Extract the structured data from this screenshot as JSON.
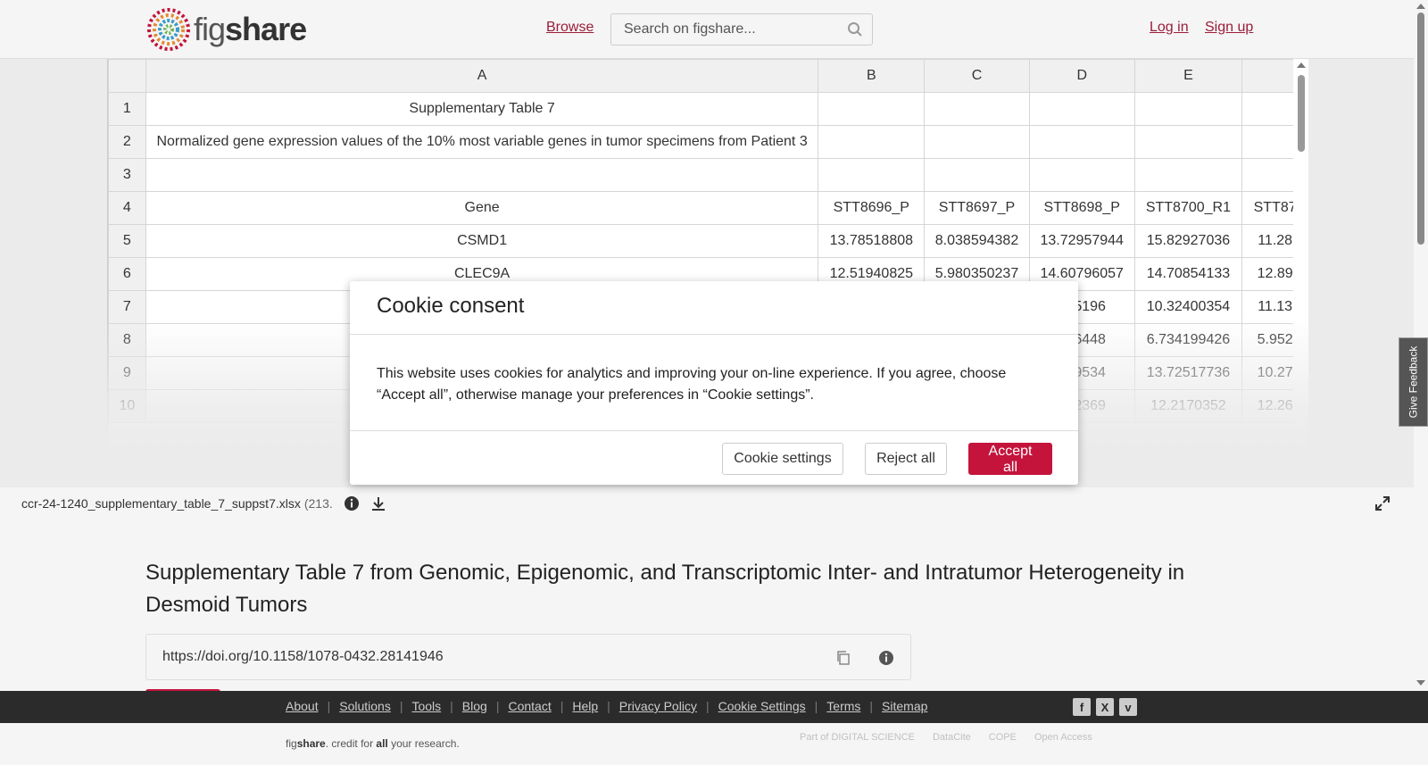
{
  "header": {
    "logo_prefix": "fig",
    "logo_suffix": "share",
    "browse": "Browse",
    "search_placeholder": "Search on figshare...",
    "login": "Log in",
    "signup": "Sign up"
  },
  "sheet": {
    "columns": [
      "A",
      "B",
      "C",
      "D",
      "E"
    ],
    "rows": [
      {
        "num": "1",
        "cells": [
          "Supplementary Table 7",
          "",
          "",
          "",
          "",
          ""
        ]
      },
      {
        "num": "2",
        "cells": [
          "Normalized gene expression values of the 10% most variable genes in tumor specimens from Patient 3",
          "",
          "",
          "",
          "",
          ""
        ]
      },
      {
        "num": "3",
        "cells": [
          "",
          "",
          "",
          "",
          "",
          ""
        ]
      },
      {
        "num": "4",
        "cells": [
          "Gene",
          "STT8696_P",
          "STT8697_P",
          "STT8698_P",
          "STT8700_R1",
          "STT87"
        ]
      },
      {
        "num": "5",
        "cells": [
          "CSMD1",
          "13.78518808",
          "8.038594382",
          "13.72957944",
          "15.82927036",
          "11.28"
        ]
      },
      {
        "num": "6",
        "cells": [
          "CLEC9A",
          "12.51940825",
          "5.980350237",
          "14.60796057",
          "14.70854133",
          "12.89"
        ]
      },
      {
        "num": "7",
        "cells": [
          "",
          "",
          "",
          "015196",
          "10.32400354",
          "11.13"
        ]
      },
      {
        "num": "8",
        "cells": [
          "",
          "",
          "",
          "546448",
          "6.734199426",
          "5.952"
        ]
      },
      {
        "num": "9",
        "cells": [
          "",
          "",
          "",
          "649534",
          "13.72517736",
          "10.27"
        ]
      },
      {
        "num": "10",
        "cells": [
          "",
          "",
          "",
          "822369",
          "12.2170352",
          "12.26"
        ]
      }
    ]
  },
  "file": {
    "name": "ccr-24-1240_supplementary_table_7_suppst7.xlsx",
    "size": "(213."
  },
  "article": {
    "title": "Supplementary Table 7 from Genomic, Epigenomic, and Transcriptomic Inter- and Intratumor Heterogeneity in Desmoid Tumors",
    "doi": "https://doi.org/10.1158/1078-0432.28141946"
  },
  "feedback": "Give Feedback",
  "footer": {
    "links": [
      "About",
      "Solutions",
      "Tools",
      "Blog",
      "Contact",
      "Help",
      "Privacy Policy",
      "Cookie Settings",
      "Terms",
      "Sitemap"
    ],
    "tagline_fig": "fig",
    "tagline_share": "share",
    "tagline_mid": ". credit for ",
    "tagline_all": "all",
    "tagline_end": " your research.",
    "partners": [
      "Part of DIGITAL SCIENCE",
      "DataCite",
      "COPE",
      "Open Access"
    ]
  },
  "cookie": {
    "title": "Cookie consent",
    "body": "This website uses cookies for analytics and improving your on-line experience. If you agree, choose “Accept all”, otherwise manage your preferences in “Cookie settings”.",
    "settings": "Cookie settings",
    "reject": "Reject all",
    "accept": "Accept all"
  },
  "colors": {
    "brand": "#c4143c",
    "link": "#9b1c3a"
  }
}
